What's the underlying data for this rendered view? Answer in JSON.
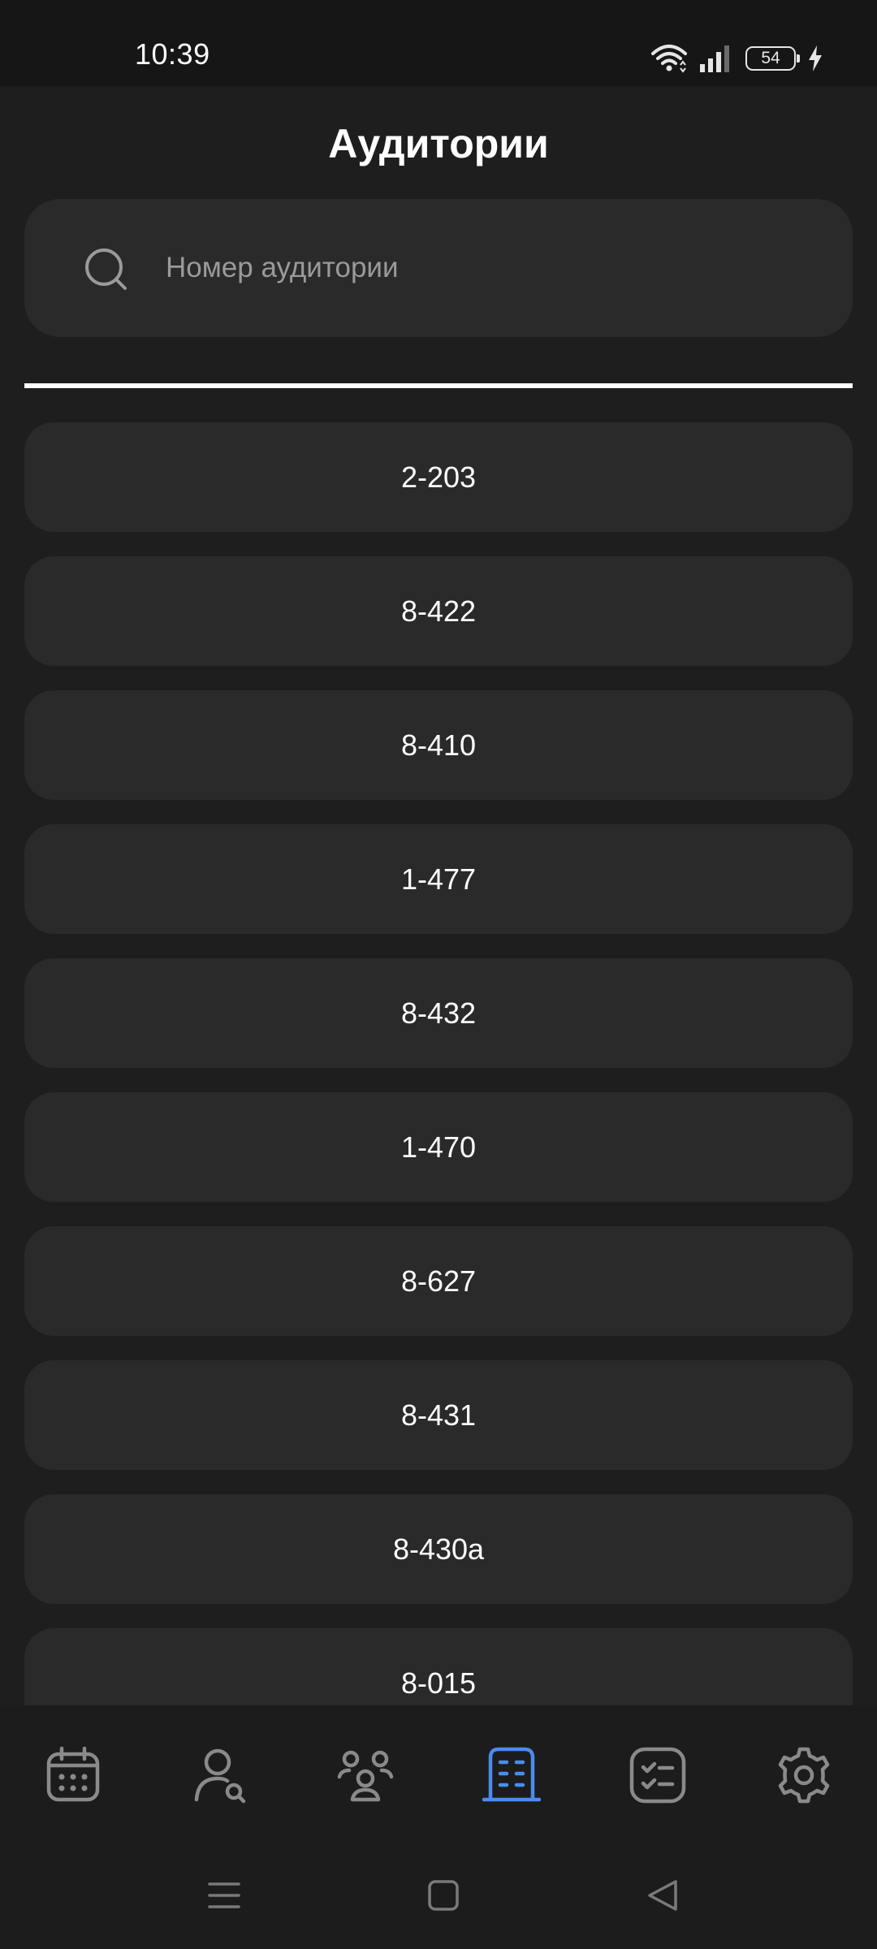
{
  "status_bar": {
    "time": "10:39",
    "battery_level": "54",
    "icons": [
      "wifi-icon",
      "signal-icon",
      "battery-icon",
      "charging-icon"
    ]
  },
  "header": {
    "title": "Аудитории"
  },
  "search": {
    "placeholder": "Номер аудитории",
    "value": ""
  },
  "rooms": [
    {
      "label": "2-203"
    },
    {
      "label": "8-422"
    },
    {
      "label": "8-410"
    },
    {
      "label": "1-477"
    },
    {
      "label": "8-432"
    },
    {
      "label": "1-470"
    },
    {
      "label": "8-627"
    },
    {
      "label": "8-431"
    },
    {
      "label": "8-430а"
    },
    {
      "label": "8-015"
    }
  ],
  "bottom_nav": {
    "active": "rooms",
    "items": [
      {
        "id": "schedule",
        "icon": "calendar-icon"
      },
      {
        "id": "teachers",
        "icon": "person-search-icon"
      },
      {
        "id": "groups",
        "icon": "group-icon"
      },
      {
        "id": "rooms",
        "icon": "building-icon"
      },
      {
        "id": "tasks",
        "icon": "checklist-icon"
      },
      {
        "id": "settings",
        "icon": "gear-icon"
      }
    ]
  },
  "colors": {
    "background": "#1e1e1e",
    "card": "#2a2a2a",
    "accent": "#4a8cf0",
    "icon_inactive": "#8a8a8a"
  }
}
